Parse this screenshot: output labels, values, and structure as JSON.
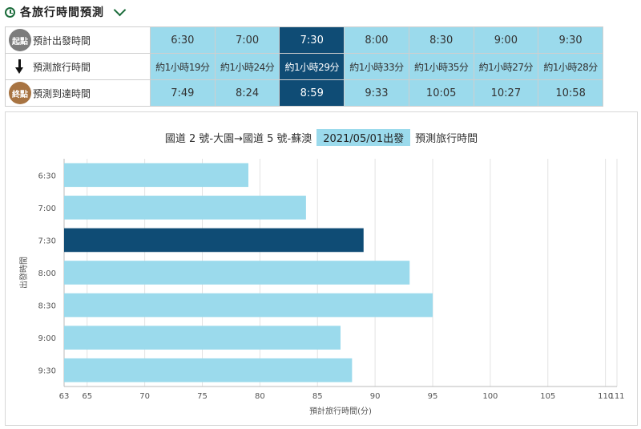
{
  "header": {
    "title": "各旅行時間預測"
  },
  "schedule": {
    "rows": {
      "depart": {
        "badge": "起點",
        "label": "預計出發時間"
      },
      "duration": {
        "label": "預測旅行時間"
      },
      "arrive": {
        "badge": "終點",
        "label": "預測到達時間"
      }
    },
    "selected_index": 2,
    "columns": [
      {
        "depart": "6:30",
        "duration": "約1小時19分",
        "arrive": "7:49"
      },
      {
        "depart": "7:00",
        "duration": "約1小時24分",
        "arrive": "8:24"
      },
      {
        "depart": "7:30",
        "duration": "約1小時29分",
        "arrive": "8:59"
      },
      {
        "depart": "8:00",
        "duration": "約1小時33分",
        "arrive": "9:33"
      },
      {
        "depart": "8:30",
        "duration": "約1小時35分",
        "arrive": "10:05"
      },
      {
        "depart": "9:00",
        "duration": "約1小時27分",
        "arrive": "10:27"
      },
      {
        "depart": "9:30",
        "duration": "約1小時28分",
        "arrive": "10:58"
      }
    ]
  },
  "chart_data": {
    "type": "bar",
    "orientation": "horizontal",
    "title": "國道 2 號-大園→國道 5 號-蘇澳",
    "title_date": "2021/05/01出發",
    "title_suffix": "預測旅行時間",
    "categories": [
      "6:30",
      "7:00",
      "7:30",
      "8:00",
      "8:30",
      "9:00",
      "9:30"
    ],
    "values": [
      79,
      84,
      89,
      93,
      95,
      87,
      88
    ],
    "highlight_index": 2,
    "xlabel": "預計旅行時間(分)",
    "ylabel": "出發時間",
    "xlim": [
      63,
      111
    ],
    "xticks": [
      "63",
      "65",
      "70",
      "75",
      "80",
      "85",
      "90",
      "95",
      "100",
      "105",
      "110",
      "111"
    ],
    "xtick_values": [
      63,
      65,
      70,
      75,
      80,
      85,
      90,
      95,
      100,
      105,
      110,
      111
    ],
    "grid": true,
    "colors": {
      "bar": "#9bdaec",
      "highlight": "#0f4c75"
    }
  }
}
